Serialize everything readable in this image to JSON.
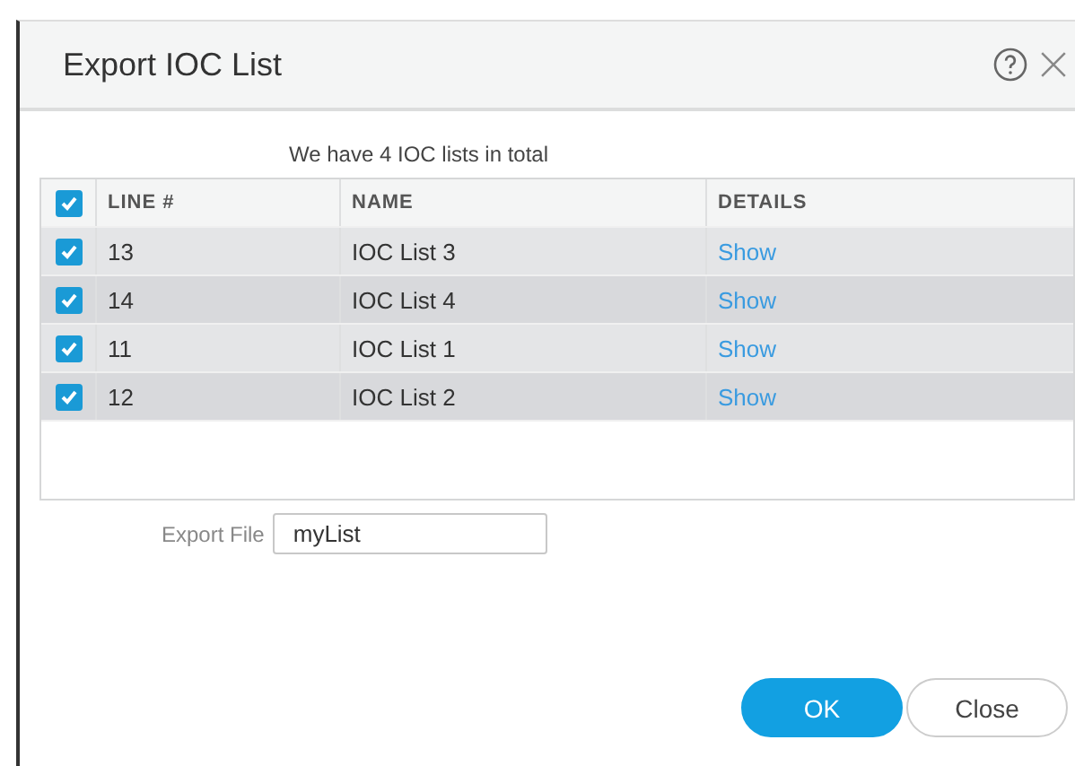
{
  "dialog": {
    "title": "Export IOC List"
  },
  "summary": "We have 4 IOC lists in total",
  "table": {
    "header_checked": true,
    "columns": [
      "LINE #",
      "NAME",
      "DETAILS"
    ],
    "rows": [
      {
        "checked": true,
        "line": "13",
        "name": "IOC List 3",
        "details": "Show"
      },
      {
        "checked": true,
        "line": "14",
        "name": "IOC List 4",
        "details": "Show"
      },
      {
        "checked": true,
        "line": "11",
        "name": "IOC List 1",
        "details": "Show"
      },
      {
        "checked": true,
        "line": "12",
        "name": "IOC List 2",
        "details": "Show"
      }
    ]
  },
  "export_file": {
    "label": "Export File",
    "value": "myList"
  },
  "buttons": [
    {
      "label": "OK",
      "kind": "primary"
    },
    {
      "label": "Close",
      "kind": "secondary"
    }
  ]
}
